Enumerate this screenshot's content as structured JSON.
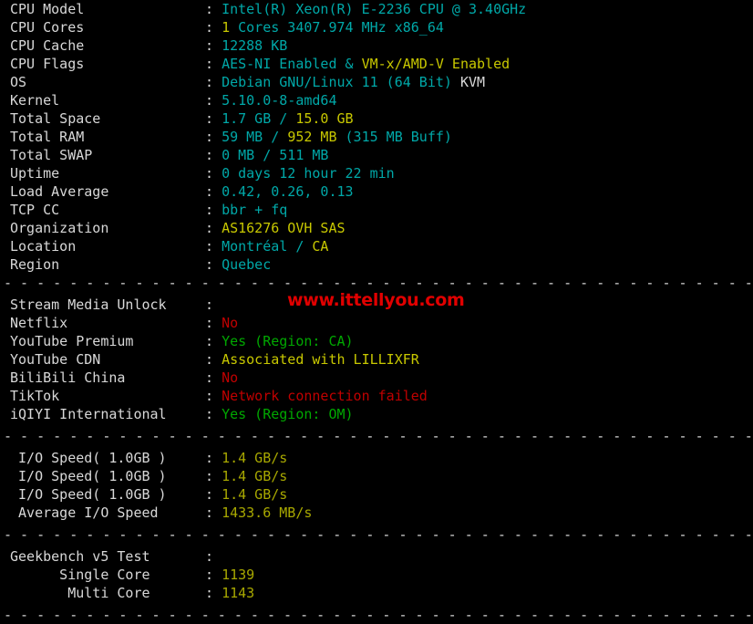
{
  "terminal": {
    "background": "#000000",
    "separator_line": "- - - - - - - - - - - - - - - - - - - - - - - - - - - - - - - - - - - - - - - - - - - - - - - - - - - - - - - - - - - - - - - - - - - - - - - - - - - -",
    "colon": ":"
  },
  "watermark": {
    "text": "www.ittellyou.com",
    "color": "#e00000"
  },
  "colors": {
    "cyan": "#00a8a8",
    "yellow": "#c8c800",
    "olive": "#a8a800",
    "green": "#00a800",
    "red": "#c00000",
    "white": "#d8d8d8"
  },
  "sections": {
    "system": {
      "rows": [
        {
          "label": "CPU Model",
          "parts": [
            {
              "text": "Intel(R) Xeon(R) E-2236 CPU @ 3.40GHz",
              "color": "cyan"
            }
          ]
        },
        {
          "label": "CPU Cores",
          "parts": [
            {
              "text": "1",
              "color": "yellow"
            },
            {
              "text": " Cores 3407.974 MHz x86_64",
              "color": "cyan"
            }
          ]
        },
        {
          "label": "CPU Cache",
          "parts": [
            {
              "text": "12288 KB",
              "color": "cyan"
            }
          ]
        },
        {
          "label": "CPU Flags",
          "parts": [
            {
              "text": "AES-NI Enabled",
              "color": "cyan"
            },
            {
              "text": " & ",
              "color": "cyan"
            },
            {
              "text": "VM-x/AMD-V Enabled",
              "color": "yellow"
            }
          ]
        },
        {
          "label": "OS",
          "parts": [
            {
              "text": "Debian GNU/Linux 11 (64 Bit) ",
              "color": "cyan"
            },
            {
              "text": "KVM",
              "color": "white"
            }
          ]
        },
        {
          "label": "Kernel",
          "parts": [
            {
              "text": "5.10.0-8-amd64",
              "color": "cyan"
            }
          ]
        },
        {
          "label": "Total Space",
          "parts": [
            {
              "text": "1.7 GB ",
              "color": "cyan"
            },
            {
              "text": "/ ",
              "color": "cyan"
            },
            {
              "text": "15.0 GB",
              "color": "yellow"
            }
          ]
        },
        {
          "label": "Total RAM",
          "parts": [
            {
              "text": "59 MB ",
              "color": "cyan"
            },
            {
              "text": "/ ",
              "color": "cyan"
            },
            {
              "text": "952 MB",
              "color": "yellow"
            },
            {
              "text": " (315 MB Buff)",
              "color": "cyan"
            }
          ]
        },
        {
          "label": "Total SWAP",
          "parts": [
            {
              "text": "0 MB / 511 MB",
              "color": "cyan"
            }
          ]
        },
        {
          "label": "Uptime",
          "parts": [
            {
              "text": "0 days 12 hour 22 min",
              "color": "cyan"
            }
          ]
        },
        {
          "label": "Load Average",
          "parts": [
            {
              "text": "0.42, 0.26, 0.13",
              "color": "cyan"
            }
          ]
        },
        {
          "label": "TCP CC",
          "parts": [
            {
              "text": "bbr + fq",
              "color": "cyan"
            }
          ]
        },
        {
          "label": "Organization",
          "parts": [
            {
              "text": "AS16276 OVH SAS",
              "color": "yellow"
            }
          ]
        },
        {
          "label": "Location",
          "parts": [
            {
              "text": "Montréal ",
              "color": "cyan"
            },
            {
              "text": "/ ",
              "color": "cyan"
            },
            {
              "text": "CA",
              "color": "yellow"
            }
          ]
        },
        {
          "label": "Region",
          "parts": [
            {
              "text": "Quebec",
              "color": "cyan"
            }
          ]
        }
      ]
    },
    "stream_media": {
      "rows": [
        {
          "label": "Stream Media Unlock",
          "parts": []
        },
        {
          "label": "Netflix",
          "parts": [
            {
              "text": "No",
              "color": "red"
            }
          ]
        },
        {
          "label": "YouTube Premium",
          "parts": [
            {
              "text": "Yes (Region: CA)",
              "color": "green"
            }
          ]
        },
        {
          "label": "YouTube CDN",
          "parts": [
            {
              "text": "Associated with LILLIXFR",
              "color": "yellow"
            }
          ]
        },
        {
          "label": "BiliBili China",
          "parts": [
            {
              "text": "No",
              "color": "red"
            }
          ]
        },
        {
          "label": "TikTok",
          "parts": [
            {
              "text": "Network connection failed",
              "color": "red"
            }
          ]
        },
        {
          "label": "iQIYI International",
          "parts": [
            {
              "text": "Yes (Region: OM)",
              "color": "green"
            }
          ]
        }
      ]
    },
    "io_speed": {
      "rows": [
        {
          "label": " I/O Speed( 1.0GB )",
          "parts": [
            {
              "text": "1.4 GB/s",
              "color": "olive"
            }
          ]
        },
        {
          "label": " I/O Speed( 1.0GB )",
          "parts": [
            {
              "text": "1.4 GB/s",
              "color": "olive"
            }
          ]
        },
        {
          "label": " I/O Speed( 1.0GB )",
          "parts": [
            {
              "text": "1.4 GB/s",
              "color": "olive"
            }
          ]
        },
        {
          "label": " Average I/O Speed",
          "parts": [
            {
              "text": "1433.6 MB/s",
              "color": "olive"
            }
          ]
        }
      ]
    },
    "geekbench": {
      "rows": [
        {
          "label": "Geekbench v5 Test",
          "parts": []
        },
        {
          "label": "      Single Core",
          "parts": [
            {
              "text": "1139",
              "color": "olive"
            }
          ]
        },
        {
          "label": "       Multi Core",
          "parts": [
            {
              "text": "1143",
              "color": "olive"
            }
          ]
        }
      ]
    }
  }
}
